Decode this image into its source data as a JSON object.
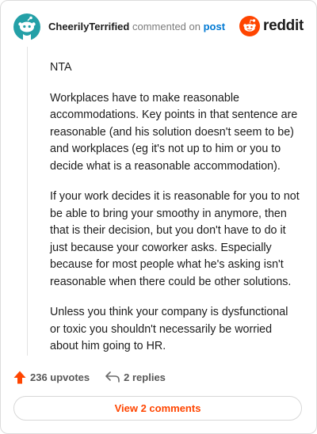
{
  "header": {
    "username": "CheerilyTerrified",
    "action_text": "commented on",
    "post_link": "post",
    "brand_name": "reddit"
  },
  "comment": {
    "paragraphs": [
      "NTA",
      "Workplaces have to make reasonable accommodations. Key points in that sentence are reasonable (and his solution doesn't seem to be) and workplaces (eg it's not up to him or you to decide what is a reasonable accommodation).",
      "If your work decides it is reasonable for you to not be able to bring your smoothy in anymore, then that is their decision, but you don't have to do it just because your coworker asks. Especially because for most people what he's asking isn't reasonable when there could be other solutions.",
      "Unless you think your company is dysfunctional or toxic you shouldn't necessarily be worried about him going to HR."
    ]
  },
  "actions": {
    "upvotes_label": "236 upvotes",
    "replies_label": "2 replies"
  },
  "footer": {
    "view_comments_label": "View 2 comments"
  },
  "colors": {
    "brand_orange": "#ff4500",
    "link_blue": "#0079d3",
    "avatar_teal": "#24a0a7"
  },
  "icons": [
    "snoo-avatar-icon",
    "reddit-logo-icon",
    "upvote-arrow-icon",
    "reply-arrow-icon"
  ]
}
